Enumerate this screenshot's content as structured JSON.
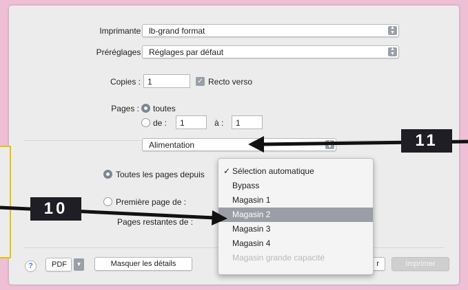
{
  "printer": {
    "label": "Imprimante :",
    "value": "lb-grand format"
  },
  "presets": {
    "label": "Préréglages :",
    "value": "Réglages par défaut"
  },
  "copies": {
    "label": "Copies :",
    "value": "1",
    "duplex_label": "Recto verso",
    "duplex_checked": true
  },
  "pages": {
    "label": "Pages :",
    "all_label": "toutes",
    "from_label": "de :",
    "from_value": "1",
    "to_label": "à :",
    "to_value": "1"
  },
  "section_popup": {
    "value": "Alimentation"
  },
  "feed": {
    "all_pages_from_label": "Toutes les pages depuis",
    "first_page_from_label": "Première page de :",
    "remaining_pages_label": "Pages restantes de :"
  },
  "dropdown": {
    "items": [
      {
        "label": "Sélection automatique",
        "checked": true,
        "state": "normal"
      },
      {
        "label": "Bypass",
        "checked": false,
        "state": "normal"
      },
      {
        "label": "Magasin 1",
        "checked": false,
        "state": "normal"
      },
      {
        "label": "Magasin 2",
        "checked": false,
        "state": "highlighted"
      },
      {
        "label": "Magasin 3",
        "checked": false,
        "state": "normal"
      },
      {
        "label": "Magasin 4",
        "checked": false,
        "state": "normal"
      },
      {
        "label": "Magasin grande capacité",
        "checked": false,
        "state": "disabled"
      }
    ]
  },
  "footer": {
    "help_label": "?",
    "pdf_label": "PDF",
    "details_label": "Masquer les détails",
    "cancel_label": "r",
    "print_label": "Imprimer"
  },
  "annotations": {
    "tag_10": "10",
    "tag_11": "11"
  },
  "colors": {
    "background": "#efbfd6",
    "panel": "#ececec",
    "highlight": "#9b9ea6",
    "tag": "#1e1e24",
    "frame": "#e5c300"
  },
  "icons": {
    "check": "checkmark-icon",
    "stepper": "up-down-chevron-icon",
    "arrow": "arrow-icon"
  }
}
